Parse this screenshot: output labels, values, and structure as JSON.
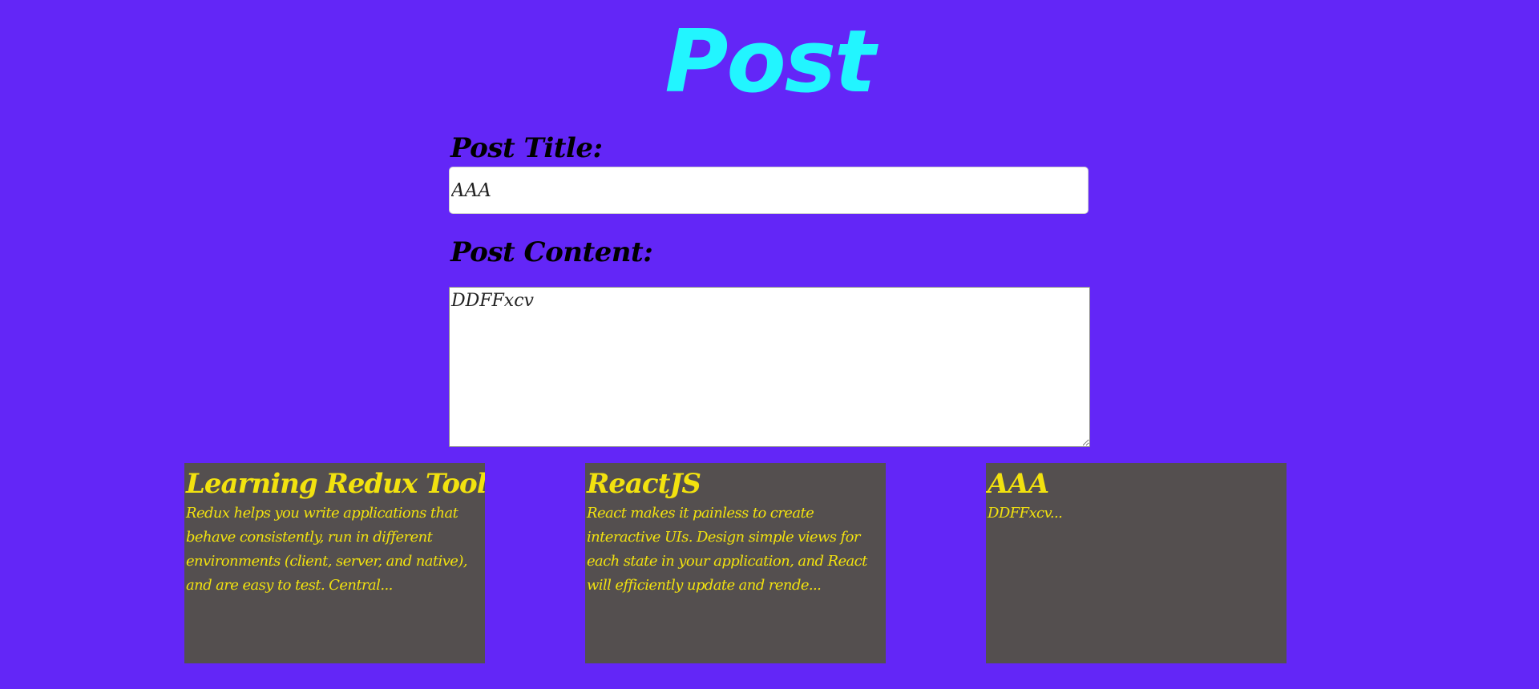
{
  "page": {
    "title": "Post"
  },
  "form": {
    "title_label": "Post Title:",
    "title_value": "AAA",
    "content_label": "Post Content:",
    "content_value": "DDFFxcv"
  },
  "posts": [
    {
      "title": "Learning Redux Toolkit",
      "excerpt": "Redux helps you write applications that behave consistently, run in different environments (client, server, and native), and are easy to test. Central..."
    },
    {
      "title": "ReactJS",
      "excerpt": "React makes it painless to create interactive UIs. Design simple views for each state in your application, and React will efficiently update and rende..."
    },
    {
      "title": "AAA",
      "excerpt": "DDFFxcv..."
    }
  ],
  "colors": {
    "background": "#6326f7",
    "heading": "#22f5ff",
    "card_background": "#544f4f",
    "card_text": "#f2e20f"
  }
}
